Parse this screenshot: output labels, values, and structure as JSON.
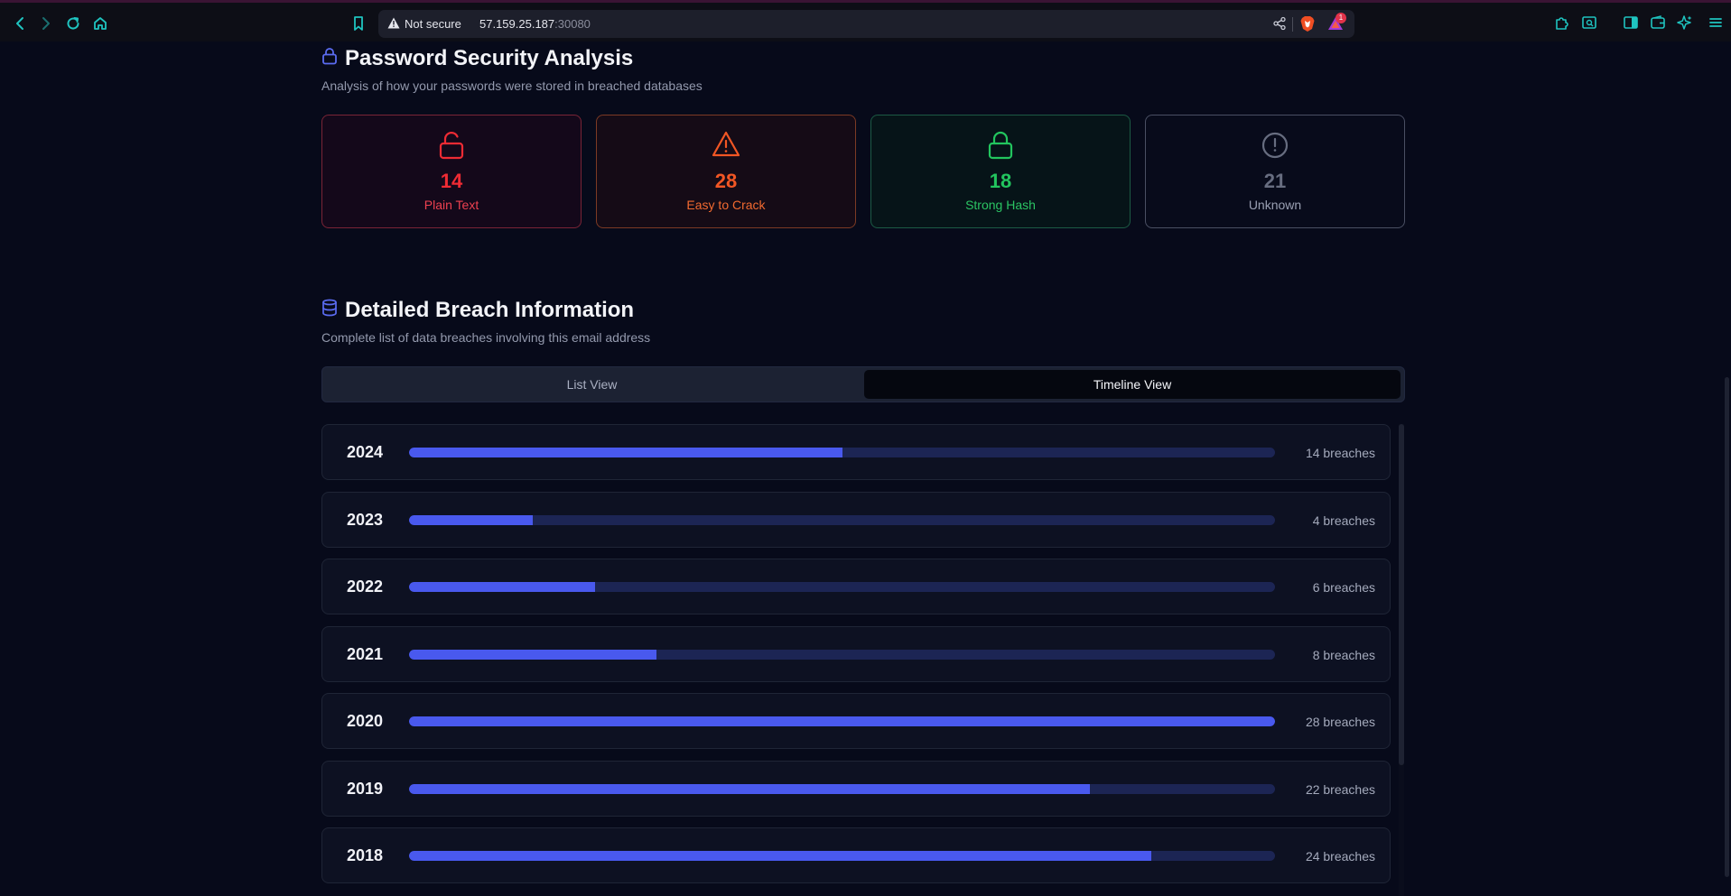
{
  "browser": {
    "security_label": "Not secure",
    "host": "57.159.25.187",
    "port": ":30080",
    "badge_count": "1",
    "icons": [
      "back-icon",
      "forward-icon",
      "reload-icon",
      "home-icon",
      "bookmark-icon",
      "warning-icon",
      "share-icon",
      "brave-shields-icon",
      "brave-rewards-icon",
      "extensions-icon",
      "reader-icon",
      "sidebar-icon",
      "wallet-icon",
      "leo-ai-icon",
      "menu-icon"
    ]
  },
  "password_section": {
    "title": "Password Security Analysis",
    "subtitle": "Analysis of how your passwords were stored in breached databases",
    "icon": "lock-icon",
    "cards": [
      {
        "value": "14",
        "label": "Plain Text",
        "icon": "unlock-icon",
        "color": "#ef2b34"
      },
      {
        "value": "28",
        "label": "Easy to Crack",
        "icon": "warning-triangle-icon",
        "color": "#f15624"
      },
      {
        "value": "18",
        "label": "Strong Hash",
        "icon": "lock-icon",
        "color": "#22c55e"
      },
      {
        "value": "21",
        "label": "Unknown",
        "icon": "alert-circle-icon",
        "color": "#676d80"
      }
    ]
  },
  "breach_section": {
    "title": "Detailed Breach Information",
    "subtitle": "Complete list of data breaches involving this email address",
    "icon": "database-icon",
    "tabs": {
      "list": "List View",
      "timeline": "Timeline View",
      "active": "timeline"
    }
  },
  "timeline": {
    "max_breaches": 28,
    "rows": [
      {
        "year": "2024",
        "count": 14,
        "label": "14 breaches"
      },
      {
        "year": "2023",
        "count": 4,
        "label": "4 breaches"
      },
      {
        "year": "2022",
        "count": 6,
        "label": "6 breaches"
      },
      {
        "year": "2021",
        "count": 8,
        "label": "8 breaches"
      },
      {
        "year": "2020",
        "count": 28,
        "label": "28 breaches"
      },
      {
        "year": "2019",
        "count": 22,
        "label": "22 breaches"
      },
      {
        "year": "2018",
        "count": 24,
        "label": "24 breaches"
      }
    ]
  },
  "colors": {
    "background": "#070a1a",
    "accent": "#4959ee",
    "track": "#1c2554",
    "chrome_accent": "#1fc4c0"
  }
}
